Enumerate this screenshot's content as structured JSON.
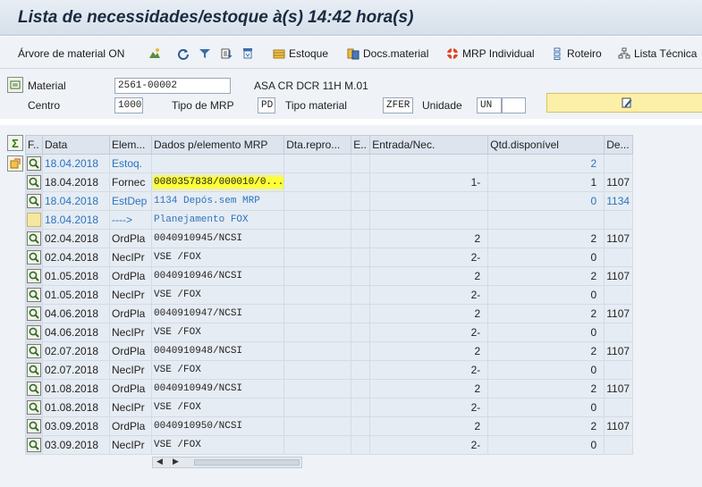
{
  "window": {
    "title": "Lista de necessidades/estoque à(s) 14:42 hora(s)"
  },
  "toolbar": {
    "material_tree": "Árvore de material ON",
    "estoque": "Estoque",
    "docs_material": "Docs.material",
    "mrp_individual": "MRP Individual",
    "roteiro": "Roteiro",
    "lista_tecnica": "Lista Técnica"
  },
  "header": {
    "material_label": "Material",
    "material_value": "2561-00002",
    "material_desc": "ASA CR DCR 11H M.01",
    "centro_label": "Centro",
    "centro_value": "1000",
    "tipo_mrp_label": "Tipo de MRP",
    "tipo_mrp_value": "PD",
    "tipo_material_label": "Tipo material",
    "tipo_material_value": "ZFER",
    "unidade_label": "Unidade",
    "unidade_value": "UN"
  },
  "grid": {
    "columns": [
      "F..",
      "Data",
      "Elem...",
      "Dados p/elemento MRP",
      "Dta.repro...",
      "E..",
      "Entrada/Nec.",
      "Qtd.disponível",
      "De..."
    ],
    "rows": [
      {
        "icon": "magnifier",
        "style": "blue",
        "date": "18.04.2018",
        "elem": "Estoq.",
        "dados": "",
        "dta": "",
        "e": "",
        "entrada": "",
        "qtd": "2",
        "de": ""
      },
      {
        "icon": "magnifier",
        "style": "normal",
        "highlight": true,
        "date": "18.04.2018",
        "elem": "Fornec",
        "dados": "0080357838/000010/0...",
        "dta": "",
        "e": "",
        "entrada": "1-",
        "qtd": "1",
        "de": "1107"
      },
      {
        "icon": "magnifier",
        "style": "blue",
        "date": "18.04.2018",
        "elem": "EstDep",
        "dados": "1134 Depós.sem MRP",
        "dta": "",
        "e": "",
        "entrada": "",
        "qtd": "0",
        "de": "1134"
      },
      {
        "icon": "yellow",
        "style": "blue",
        "date": "18.04.2018",
        "elem": "---->",
        "dados": "Planejamento FOX",
        "dta": "",
        "e": "",
        "entrada": "",
        "qtd": "",
        "de": ""
      },
      {
        "icon": "magnifier",
        "style": "normal",
        "date": "02.04.2018",
        "elem": "OrdPla",
        "dados": "0040910945/NCSI",
        "dta": "",
        "e": "",
        "entrada": "2",
        "qtd": "2",
        "de": "1107"
      },
      {
        "icon": "magnifier",
        "style": "normal",
        "date": "02.04.2018",
        "elem": "NecIPr",
        "dados": "VSE /FOX",
        "dta": "",
        "e": "",
        "entrada": "2-",
        "qtd": "0",
        "de": ""
      },
      {
        "icon": "magnifier",
        "style": "normal",
        "date": "01.05.2018",
        "elem": "OrdPla",
        "dados": "0040910946/NCSI",
        "dta": "",
        "e": "",
        "entrada": "2",
        "qtd": "2",
        "de": "1107"
      },
      {
        "icon": "magnifier",
        "style": "normal",
        "date": "01.05.2018",
        "elem": "NecIPr",
        "dados": "VSE /FOX",
        "dta": "",
        "e": "",
        "entrada": "2-",
        "qtd": "0",
        "de": ""
      },
      {
        "icon": "magnifier",
        "style": "normal",
        "date": "04.06.2018",
        "elem": "OrdPla",
        "dados": "0040910947/NCSI",
        "dta": "",
        "e": "",
        "entrada": "2",
        "qtd": "2",
        "de": "1107"
      },
      {
        "icon": "magnifier",
        "style": "normal",
        "date": "04.06.2018",
        "elem": "NecIPr",
        "dados": "VSE /FOX",
        "dta": "",
        "e": "",
        "entrada": "2-",
        "qtd": "0",
        "de": ""
      },
      {
        "icon": "magnifier",
        "style": "normal",
        "date": "02.07.2018",
        "elem": "OrdPla",
        "dados": "0040910948/NCSI",
        "dta": "",
        "e": "",
        "entrada": "2",
        "qtd": "2",
        "de": "1107"
      },
      {
        "icon": "magnifier",
        "style": "normal",
        "date": "02.07.2018",
        "elem": "NecIPr",
        "dados": "VSE /FOX",
        "dta": "",
        "e": "",
        "entrada": "2-",
        "qtd": "0",
        "de": ""
      },
      {
        "icon": "magnifier",
        "style": "normal",
        "date": "01.08.2018",
        "elem": "OrdPla",
        "dados": "0040910949/NCSI",
        "dta": "",
        "e": "",
        "entrada": "2",
        "qtd": "2",
        "de": "1107"
      },
      {
        "icon": "magnifier",
        "style": "normal",
        "date": "01.08.2018",
        "elem": "NecIPr",
        "dados": "VSE /FOX",
        "dta": "",
        "e": "",
        "entrada": "2-",
        "qtd": "0",
        "de": ""
      },
      {
        "icon": "magnifier",
        "style": "normal",
        "date": "03.09.2018",
        "elem": "OrdPla",
        "dados": "0040910950/NCSI",
        "dta": "",
        "e": "",
        "entrada": "2",
        "qtd": "2",
        "de": "1107"
      },
      {
        "icon": "magnifier",
        "style": "normal",
        "date": "03.09.2018",
        "elem": "NecIPr",
        "dados": "VSE /FOX",
        "dta": "",
        "e": "",
        "entrada": "2-",
        "qtd": "0",
        "de": ""
      }
    ]
  },
  "colors": {
    "blue_text": "#2a74c0",
    "highlight": "#ffff33"
  }
}
